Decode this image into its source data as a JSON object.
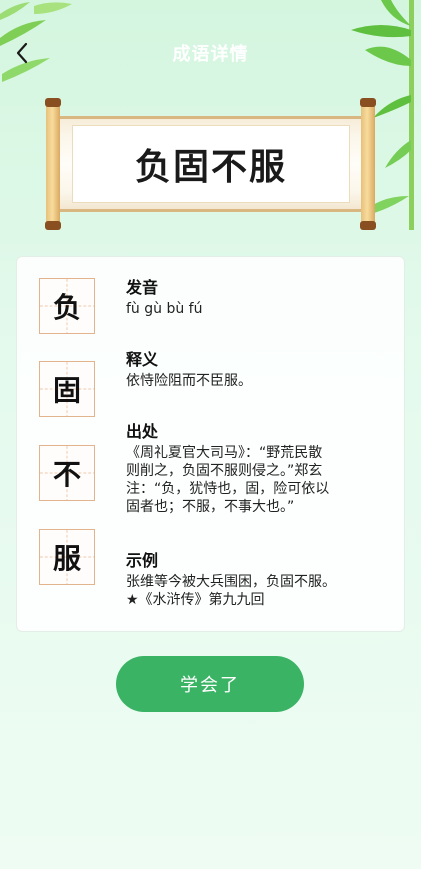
{
  "header": {
    "title": "成语详情"
  },
  "idiom": {
    "title": "负固不服",
    "chars": [
      "负",
      "固",
      "不",
      "服"
    ]
  },
  "details": {
    "pinyin": {
      "label": "发音",
      "text": "fù gù bù fú"
    },
    "meaning": {
      "label": "释义",
      "text": "依恃险阻而不臣服。"
    },
    "source": {
      "label": "出处",
      "lines": [
        "《周礼夏官大司马》：“野荒民散",
        "则削之，负固不服则侵之。”郑玄",
        "注：“负，犹恃也，固，险可依以",
        "固者也；不服，不事大也。”"
      ]
    },
    "example": {
      "label": "示例",
      "lines": [
        "张维等今被大兵围困，负固不服。",
        "★《水浒传》第九九回"
      ]
    }
  },
  "actions": {
    "learn_label": "学会了"
  },
  "colors": {
    "accent": "#3bb364",
    "char_border": "#e3b38e",
    "background": "#d4f6df"
  }
}
